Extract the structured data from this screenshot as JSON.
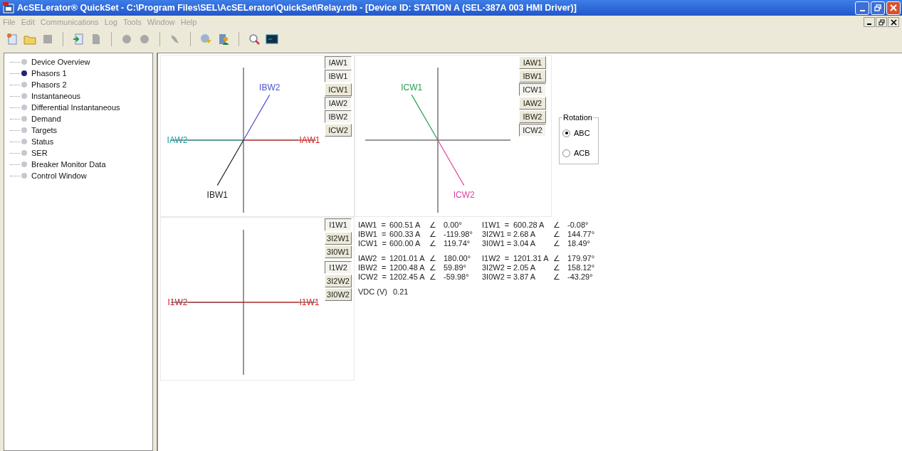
{
  "window": {
    "title": "AcSELerator® QuickSet - C:\\Program Files\\SEL\\AcSELerator\\QuickSet\\Relay.rdb - [Device ID: STATION A (SEL-387A 003 HMI Driver)]"
  },
  "menu": [
    "File",
    "Edit",
    "Communications",
    "Log",
    "Tools",
    "Window",
    "Help"
  ],
  "tree": [
    {
      "label": "Device Overview",
      "selected": false
    },
    {
      "label": "Phasors 1",
      "selected": true
    },
    {
      "label": "Phasors 2",
      "selected": false
    },
    {
      "label": "Instantaneous",
      "selected": false
    },
    {
      "label": "Differential Instantaneous",
      "selected": false
    },
    {
      "label": "Demand",
      "selected": false
    },
    {
      "label": "Targets",
      "selected": false
    },
    {
      "label": "Status",
      "selected": false
    },
    {
      "label": "SER",
      "selected": false
    },
    {
      "label": "Breaker Monitor Data",
      "selected": false
    },
    {
      "label": "Control Window",
      "selected": false
    }
  ],
  "panels": [
    {
      "buttons": [
        {
          "label": "IAW1",
          "selected": true
        },
        {
          "label": "IBW1",
          "selected": true
        },
        {
          "label": "ICW1",
          "selected": false
        },
        {
          "label": "IAW2",
          "selected": true
        },
        {
          "label": "IBW2",
          "selected": true
        },
        {
          "label": "ICW2",
          "selected": false
        }
      ],
      "phasors": [
        {
          "label": "IBW2",
          "color": "#4a50d0"
        },
        {
          "label": "IAW2",
          "color": "#18a0a0"
        },
        {
          "label": "IAW1",
          "color": "#e02020"
        },
        {
          "label": "IBW1",
          "color": "#202020"
        }
      ]
    },
    {
      "buttons": [
        {
          "label": "IAW1",
          "selected": false
        },
        {
          "label": "IBW1",
          "selected": false
        },
        {
          "label": "ICW1",
          "selected": true
        },
        {
          "label": "IAW2",
          "selected": false
        },
        {
          "label": "IBW2",
          "selected": false
        },
        {
          "label": "ICW2",
          "selected": true
        }
      ],
      "phasors": [
        {
          "label": "ICW1",
          "color": "#20a050"
        },
        {
          "label": "ICW2",
          "color": "#e0409a"
        }
      ]
    },
    {
      "buttons": [
        {
          "label": "I1W1",
          "selected": true
        },
        {
          "label": "3I2W1",
          "selected": false
        },
        {
          "label": "3I0W1",
          "selected": false
        },
        {
          "label": "I1W2",
          "selected": true
        },
        {
          "label": "3I2W2",
          "selected": false
        },
        {
          "label": "3I0W2",
          "selected": false
        }
      ],
      "phasors": [
        {
          "label": "I1W2",
          "color": "#c02030"
        },
        {
          "label": "I1W1",
          "color": "#e02020"
        }
      ]
    }
  ],
  "rotation": {
    "title": "Rotation",
    "options": [
      {
        "label": "ABC",
        "selected": true
      },
      {
        "label": "ACB",
        "selected": false
      }
    ]
  },
  "readings": [
    {
      "left": [
        {
          "label": "IAW1  =",
          "value": "600.51 A",
          "sign": "∠",
          "angle": "0.00°"
        },
        {
          "label": "IBW1  =",
          "value": "600.33 A",
          "sign": "∠",
          "angle": "-119.98°"
        },
        {
          "label": "ICW1  =",
          "value": "600.00 A",
          "sign": "∠",
          "angle": "119.74°"
        }
      ],
      "right": [
        {
          "label": "I1W1  =",
          "value": "600.28 A",
          "sign": "∠",
          "angle": "-0.08°"
        },
        {
          "label": "3I2W1 =",
          "value": "2.68 A",
          "sign": "∠",
          "angle": "144.77°"
        },
        {
          "label": "3I0W1 =",
          "value": "3.04 A",
          "sign": "∠",
          "angle": "18.49°"
        }
      ]
    },
    {
      "left": [
        {
          "label": "IAW2  =",
          "value": "1201.01 A",
          "sign": "∠",
          "angle": "180.00°"
        },
        {
          "label": "IBW2  =",
          "value": "1200.48 A",
          "sign": "∠",
          "angle": "59.89°"
        },
        {
          "label": "ICW2  =",
          "value": "1202.45 A",
          "sign": "∠",
          "angle": "-59.98°"
        }
      ],
      "right": [
        {
          "label": "I1W2  =",
          "value": "1201.31 A",
          "sign": "∠",
          "angle": "179.97°"
        },
        {
          "label": "3I2W2 =",
          "value": "2.05 A",
          "sign": "∠",
          "angle": "158.12°"
        },
        {
          "label": "3I0W2 =",
          "value": "3.87 A",
          "sign": "∠",
          "angle": "-43.29°"
        }
      ]
    }
  ],
  "vdc": {
    "label": "VDC (V)",
    "value": "0.21"
  }
}
